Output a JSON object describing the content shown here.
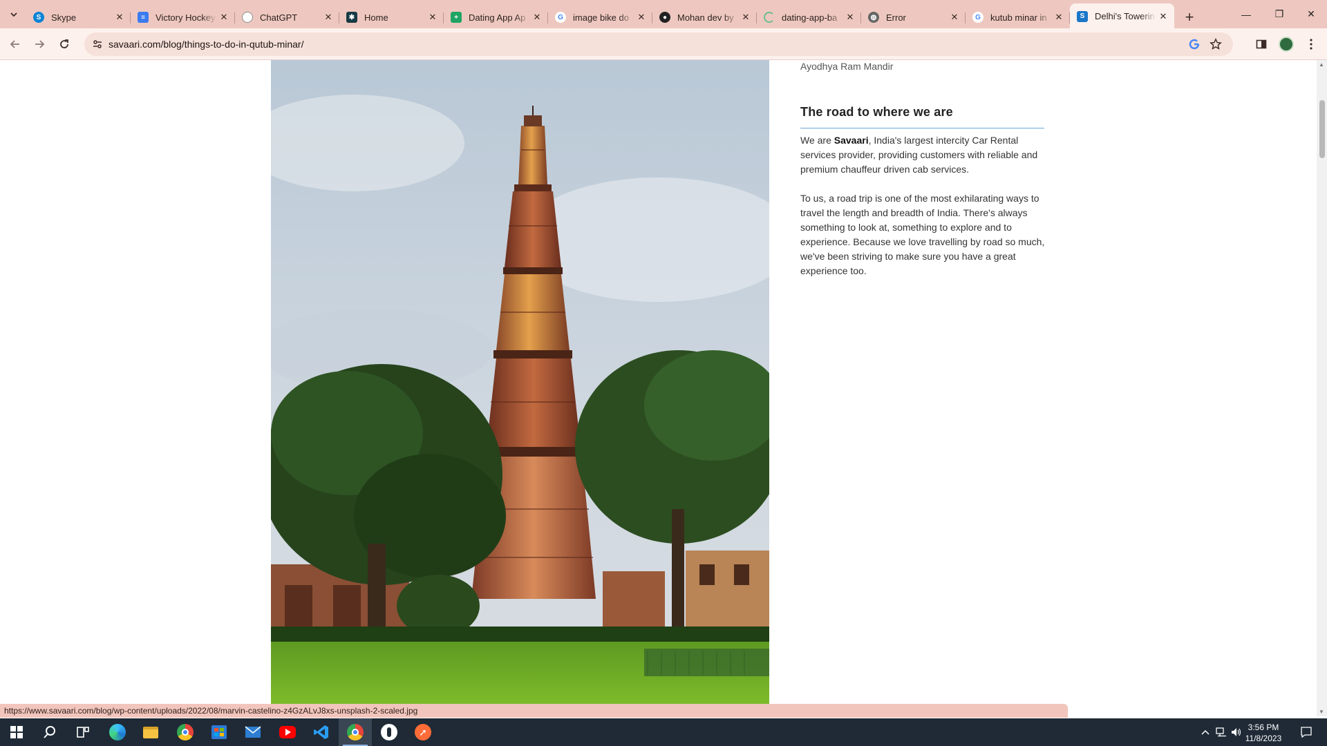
{
  "browser": {
    "tabs": [
      {
        "title": "Skype",
        "favicon": "skype-icon",
        "color": "#0a84d6"
      },
      {
        "title": "Victory Hockey",
        "favicon": "docs-icon",
        "color": "#3b7bf0"
      },
      {
        "title": "ChatGPT",
        "favicon": "chatgpt-icon",
        "color": "#8a8a8a"
      },
      {
        "title": "Home",
        "favicon": "home-app-icon",
        "color": "#173a44"
      },
      {
        "title": "Dating App Ap",
        "favicon": "sheets-icon",
        "color": "#1fa463"
      },
      {
        "title": "image bike do",
        "favicon": "google-icon",
        "color": "#4285f4"
      },
      {
        "title": "Mohan dev by",
        "favicon": "github-icon",
        "color": "#222222"
      },
      {
        "title": "dating-app-ba",
        "favicon": "loading-icon",
        "color": "#6bbf8f"
      },
      {
        "title": "Error",
        "favicon": "globe-icon",
        "color": "#666666"
      },
      {
        "title": "kutub minar in",
        "favicon": "google-icon",
        "color": "#4285f4"
      },
      {
        "title": "Delhi's Towerin",
        "favicon": "savaari-icon",
        "color": "#1b76c8"
      }
    ],
    "active_tab_index": 10,
    "url": "savaari.com/blog/things-to-do-in-qutub-minar/",
    "status_url": "https://www.savaari.com/blog/wp-content/uploads/2022/08/marvin-castelino-z4GzALvJ8xs-unsplash-2-scaled.jpg"
  },
  "page": {
    "prev_link": "Ayodhya Ram Mandir",
    "sidebar_heading": "The road to where we are",
    "para1_pre": "We are ",
    "para1_brand": "Savaari",
    "para1_post": ", India's largest intercity Car Rental services provider, providing customers with reliable and premium chauffeur driven cab services.",
    "para2": "To us, a road trip is one of the most exhilarating ways to travel the length and breadth of India. There's always something to look at, something to explore and to experience. Because we love travelling by road so much, we've been striving to make sure you have a great experience too.",
    "hero_image": "qutub-minar-photo"
  },
  "taskbar": {
    "time": "3:56 PM",
    "date": "11/8/2023"
  },
  "colors": {
    "tabstrip": "#eec8c0",
    "toolbar": "#fdf1ee",
    "accent_line": "#6aa8d8",
    "taskbar": "#1f2a36"
  }
}
